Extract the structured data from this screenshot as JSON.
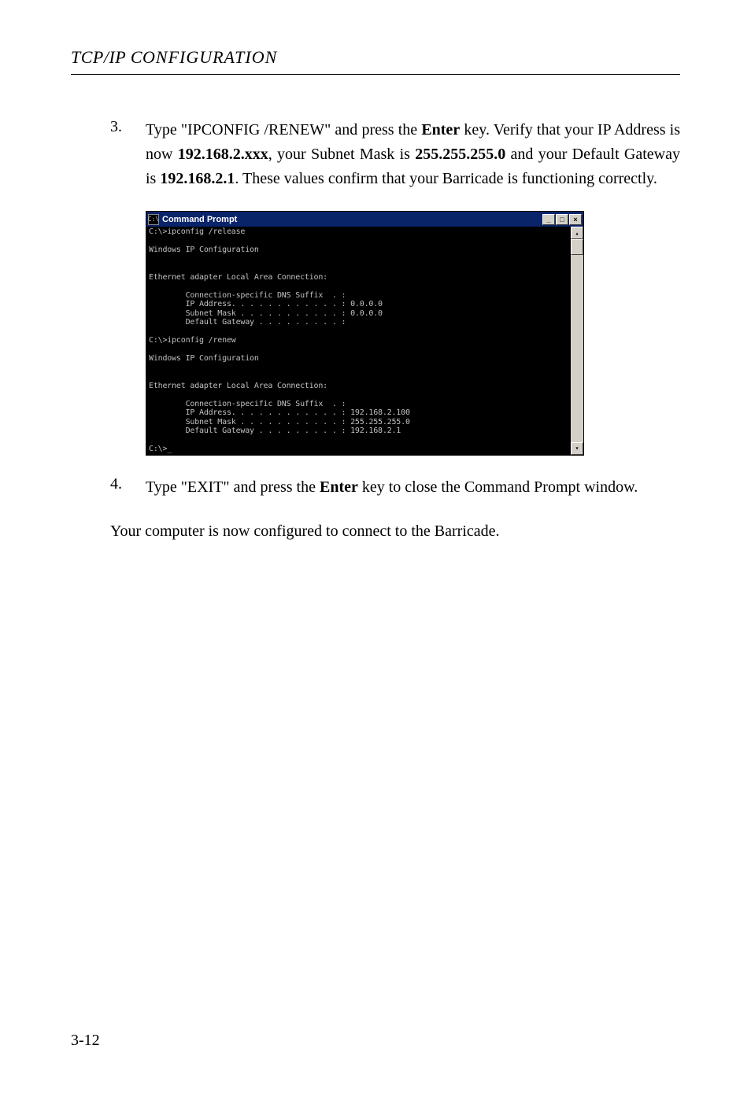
{
  "header": {
    "prefix": "TCP/IP C",
    "smallcaps": "ONFIGURATION"
  },
  "step3": {
    "num": "3.",
    "t1": "Type \"IPCONFIG /RENEW\" and press the ",
    "enter": "Enter",
    "t2": " key. Verify that your IP Address is now ",
    "ip": "192.168.2.xxx",
    "t3": ", your Subnet Mask is ",
    "mask": "255.255.255.0",
    "t4": " and your Default Gateway is ",
    "gw": "192.168.2.1",
    "t5": ". These values confirm that your Barricade is functioning correctly."
  },
  "cmdwin": {
    "icon": "C:\\",
    "title": "Command Prompt",
    "btn_min": "_",
    "btn_max": "□",
    "btn_close": "×",
    "sb_up": "▴",
    "sb_down": "▾",
    "term": "C:\\>ipconfig /release\n\nWindows IP Configuration\n\n\nEthernet adapter Local Area Connection:\n\n        Connection-specific DNS Suffix  . :\n        IP Address. . . . . . . . . . . . : 0.0.0.0\n        Subnet Mask . . . . . . . . . . . : 0.0.0.0\n        Default Gateway . . . . . . . . . :\n\nC:\\>ipconfig /renew\n\nWindows IP Configuration\n\n\nEthernet adapter Local Area Connection:\n\n        Connection-specific DNS Suffix  . :\n        IP Address. . . . . . . . . . . . : 192.168.2.100\n        Subnet Mask . . . . . . . . . . . : 255.255.255.0\n        Default Gateway . . . . . . . . . : 192.168.2.1\n\nC:\\>_"
  },
  "step4": {
    "num": "4.",
    "t1": "Type \"EXIT\" and press the ",
    "enter": "Enter",
    "t2": " key to close the Command Prompt window."
  },
  "closing": "Your computer is now configured to connect to the Barricade.",
  "pagenum": "3-12"
}
